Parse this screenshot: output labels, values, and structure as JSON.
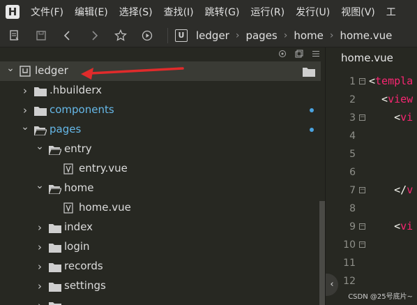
{
  "app": {
    "logo_glyph": "H"
  },
  "menu": [
    "文件(F)",
    "编辑(E)",
    "选择(S)",
    "查找(I)",
    "跳转(G)",
    "运行(R)",
    "发行(U)",
    "视图(V)",
    "工"
  ],
  "toolbar": {
    "icons": [
      "new-file-icon",
      "save-icon",
      "back-icon",
      "forward-icon",
      "favorite-icon",
      "run-icon"
    ],
    "breadcrumb": {
      "logo_glyph": "U",
      "items": [
        "ledger",
        "pages",
        "home",
        "home.vue"
      ],
      "separator": "›"
    }
  },
  "explorer": {
    "header_icons": [
      "locate-icon",
      "collapse-all-icon",
      "menu-icon"
    ],
    "tree": [
      {
        "label": "ledger",
        "type": "project",
        "expanded": true,
        "depth": 0,
        "selected": true
      },
      {
        "label": ".hbuilderx",
        "type": "folder",
        "expanded": false,
        "depth": 1
      },
      {
        "label": "components",
        "type": "folder",
        "expanded": false,
        "depth": 1,
        "modified": true
      },
      {
        "label": "pages",
        "type": "folder-open",
        "expanded": true,
        "depth": 1,
        "modified": true
      },
      {
        "label": "entry",
        "type": "folder-open",
        "expanded": true,
        "depth": 2
      },
      {
        "label": "entry.vue",
        "type": "vue-file",
        "depth": 3
      },
      {
        "label": "home",
        "type": "folder-open",
        "expanded": true,
        "depth": 2
      },
      {
        "label": "home.vue",
        "type": "vue-file",
        "depth": 3
      },
      {
        "label": "index",
        "type": "folder",
        "expanded": false,
        "depth": 2
      },
      {
        "label": "login",
        "type": "folder",
        "expanded": false,
        "depth": 2
      },
      {
        "label": "records",
        "type": "folder",
        "expanded": false,
        "depth": 2
      },
      {
        "label": "settings",
        "type": "folder",
        "expanded": false,
        "depth": 2
      },
      {
        "label": "...",
        "type": "folder",
        "expanded": false,
        "depth": 2
      }
    ]
  },
  "editor": {
    "tab": "home.vue",
    "lines": [
      {
        "n": "1",
        "fold": true,
        "code": [
          [
            "br",
            "<"
          ],
          [
            "tag",
            "templa"
          ]
        ]
      },
      {
        "n": "2",
        "fold": false,
        "code": [
          [
            "br",
            "  <"
          ],
          [
            "tag",
            "view"
          ]
        ]
      },
      {
        "n": "3",
        "fold": true,
        "code": [
          [
            "br",
            "    <"
          ],
          [
            "tag",
            "vi"
          ]
        ]
      },
      {
        "n": "4",
        "fold": false,
        "code": []
      },
      {
        "n": "5",
        "fold": false,
        "code": []
      },
      {
        "n": "6",
        "fold": false,
        "code": []
      },
      {
        "n": "7",
        "fold": true,
        "code": [
          [
            "br",
            "    </"
          ],
          [
            "tag",
            "v"
          ]
        ]
      },
      {
        "n": "8",
        "fold": false,
        "code": []
      },
      {
        "n": "9",
        "fold": true,
        "code": [
          [
            "br",
            "    <"
          ],
          [
            "tag",
            "vi"
          ]
        ]
      },
      {
        "n": "10",
        "fold": true,
        "code": []
      },
      {
        "n": "11",
        "fold": false,
        "code": []
      },
      {
        "n": "12",
        "fold": false,
        "code": []
      }
    ],
    "watermark": "CSDN @25号底片~"
  },
  "colors": {
    "background": "#272822",
    "accent_blue": "#66b8e8",
    "annotation_red": "#e02b2b",
    "tag_pink": "#f92672"
  }
}
